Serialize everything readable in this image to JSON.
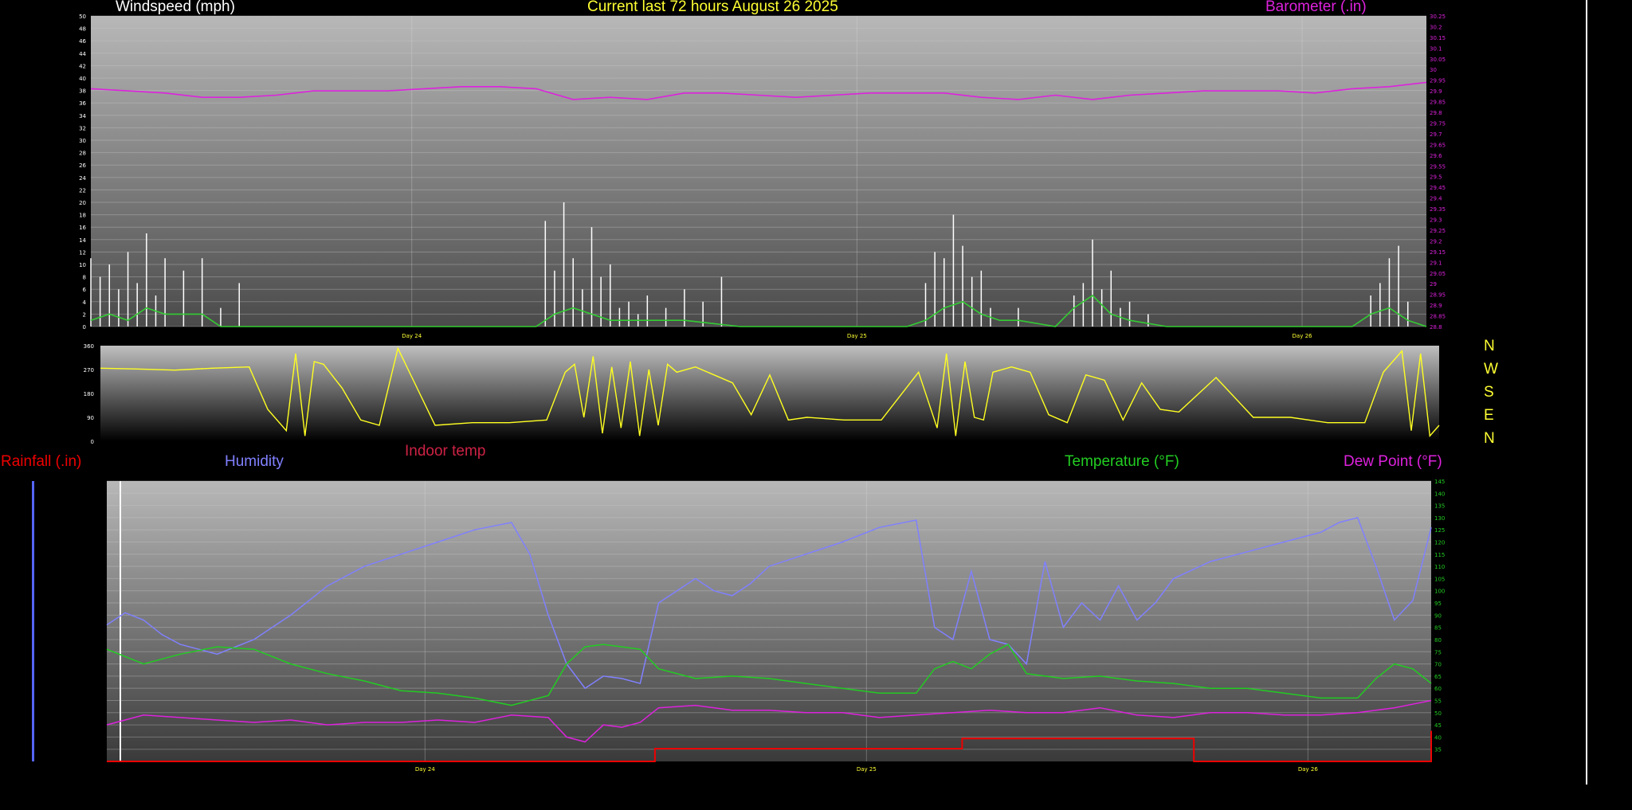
{
  "header": {
    "windspeed_label": "Windspeed (mph)",
    "title": "Current last 72 hours August 26 2025",
    "barometer_label": "Barometer (.in)"
  },
  "lower_legend": {
    "rainfall": "Rainfall (.in)",
    "humidity": "Humidity",
    "indoor_temp": "Indoor temp",
    "temperature": "Temperature (°F)",
    "dew_point": "Dew Point (°F)"
  },
  "compass": [
    "N",
    "W",
    "S",
    "E",
    "N"
  ],
  "colors": {
    "wind_gust": "#ffffff",
    "wind_avg": "#33cc33",
    "barometer": "#dd22dd",
    "direction": "#ffff22",
    "humidity": "#8080ff",
    "temperature": "#22cc22",
    "dew_point": "#dd22dd",
    "rainfall": "#ee0000",
    "indoor_temp": "#cc2244",
    "title": "#ffff33"
  },
  "chart_data": [
    {
      "type": "line",
      "title": "Current last 72 hours August 26 2025",
      "day_labels": [
        "Day 24",
        "Day 25",
        "Day 26"
      ],
      "x_unit": "hours",
      "xlim": [
        0,
        72
      ],
      "day_marks": [
        17.3,
        41.3,
        65.3
      ],
      "y_left": {
        "label": "Windspeed (mph)",
        "lim": [
          0,
          50
        ],
        "ticks": [
          0,
          2,
          4,
          6,
          8,
          10,
          12,
          14,
          16,
          18,
          20,
          22,
          24,
          26,
          28,
          30,
          32,
          34,
          36,
          38,
          40,
          42,
          44,
          46,
          48,
          50
        ]
      },
      "y_right": {
        "label": "Barometer (.in)",
        "lim": [
          28.8,
          30.25
        ],
        "ticks": [
          "28.8",
          "28.85",
          "28.9",
          "28.95",
          "29",
          "29.05",
          "29.1",
          "29.15",
          "29.2",
          "29.25",
          "29.3",
          "29.35",
          "29.4",
          "29.45",
          "29.5",
          "29.55",
          "29.6",
          "29.65",
          "29.7",
          "29.75",
          "29.8",
          "29.85",
          "29.9",
          "29.95",
          "30",
          "30.05",
          "30.1",
          "30.15",
          "30.2",
          "30.25"
        ]
      },
      "series": [
        {
          "name": "Barometer (.in)",
          "axis": "right",
          "x": [
            0,
            2,
            4,
            6,
            8,
            10,
            12,
            14,
            16,
            18,
            20,
            22,
            24,
            26,
            28,
            30,
            32,
            34,
            36,
            38,
            40,
            42,
            44,
            46,
            48,
            50,
            52,
            54,
            56,
            58,
            60,
            62,
            64,
            66,
            68,
            70,
            72
          ],
          "y": [
            29.91,
            29.9,
            29.89,
            29.87,
            29.87,
            29.88,
            29.9,
            29.9,
            29.9,
            29.91,
            29.92,
            29.92,
            29.91,
            29.86,
            29.87,
            29.86,
            29.89,
            29.89,
            29.88,
            29.87,
            29.88,
            29.89,
            29.89,
            29.89,
            29.87,
            29.86,
            29.88,
            29.86,
            29.88,
            29.89,
            29.9,
            29.9,
            29.9,
            29.89,
            29.91,
            29.92,
            29.94
          ]
        },
        {
          "name": "Wind gust",
          "axis": "left",
          "x": [
            0,
            0.5,
            1,
            1.5,
            2,
            2.5,
            3,
            3.5,
            4,
            5,
            6,
            7,
            8,
            10,
            12,
            14,
            16,
            20,
            22,
            24,
            24.5,
            25,
            25.5,
            26,
            26.5,
            27,
            27.5,
            28,
            28.5,
            29,
            29.5,
            30,
            31,
            32,
            33,
            34,
            35,
            40,
            42,
            44,
            45,
            45.5,
            46,
            46.5,
            47,
            47.5,
            48,
            48.5,
            50,
            52,
            53,
            53.5,
            54,
            54.5,
            55,
            55.5,
            56,
            57,
            58,
            60,
            64,
            68,
            69,
            69.5,
            70,
            70.5,
            71
          ],
          "y": [
            11,
            8,
            10,
            6,
            12,
            7,
            15,
            5,
            11,
            9,
            11,
            3,
            7,
            0,
            0,
            0,
            0,
            0,
            0,
            0,
            17,
            9,
            20,
            11,
            6,
            16,
            8,
            10,
            3,
            4,
            2,
            5,
            3,
            6,
            4,
            8,
            0,
            0,
            0,
            0,
            7,
            12,
            11,
            18,
            13,
            8,
            9,
            3,
            3,
            0,
            5,
            7,
            14,
            6,
            9,
            3,
            4,
            2,
            0,
            0,
            0,
            0,
            5,
            7,
            11,
            13,
            4
          ],
          "style": "bars"
        },
        {
          "name": "Wind average",
          "axis": "left",
          "x": [
            0,
            1,
            2,
            3,
            4,
            5,
            6,
            7,
            8,
            10,
            24,
            25,
            26,
            27,
            28,
            30,
            32,
            35,
            44,
            45,
            46,
            47,
            48,
            49,
            50,
            52,
            53,
            54,
            55,
            56,
            58,
            68,
            69,
            70,
            71,
            72
          ],
          "y": [
            1,
            2,
            1,
            3,
            2,
            2,
            2,
            0,
            0,
            0,
            0,
            2,
            3,
            2,
            1,
            1,
            1,
            0,
            0,
            1,
            3,
            4,
            2,
            1,
            1,
            0,
            3,
            5,
            2,
            1,
            0,
            0,
            2,
            3,
            1,
            0
          ]
        }
      ]
    },
    {
      "type": "line",
      "title": "",
      "xlim": [
        0,
        72
      ],
      "ylim": [
        0,
        360
      ],
      "yticks": [
        0,
        90,
        180,
        270,
        360
      ],
      "series": [
        {
          "name": "Wind direction",
          "axis": "left",
          "x": [
            0,
            2,
            4,
            6,
            8,
            9,
            10,
            10.5,
            11,
            11.5,
            12,
            13,
            14,
            15,
            16,
            18,
            20,
            22,
            24,
            25,
            25.5,
            26,
            26.5,
            27,
            27.5,
            28,
            28.5,
            29,
            29.5,
            30,
            30.5,
            31,
            32,
            33,
            34,
            35,
            36,
            37,
            38,
            40,
            42,
            44,
            45,
            45.5,
            46,
            46.5,
            47,
            47.5,
            48,
            49,
            50,
            51,
            52,
            53,
            54,
            55,
            56,
            57,
            58,
            60,
            62,
            64,
            66,
            68,
            69,
            70,
            70.5,
            71,
            71.5,
            72
          ],
          "y": [
            275,
            272,
            268,
            275,
            280,
            120,
            40,
            330,
            20,
            300,
            290,
            200,
            80,
            60,
            350,
            60,
            70,
            70,
            80,
            260,
            290,
            90,
            320,
            30,
            280,
            50,
            300,
            20,
            270,
            60,
            290,
            260,
            280,
            250,
            220,
            100,
            250,
            80,
            90,
            80,
            80,
            260,
            50,
            330,
            20,
            300,
            90,
            80,
            260,
            280,
            260,
            100,
            70,
            250,
            230,
            80,
            220,
            120,
            110,
            240,
            90,
            90,
            70,
            70,
            260,
            340,
            40,
            330,
            20,
            60
          ]
        }
      ]
    },
    {
      "type": "line",
      "title": "",
      "xlim": [
        0,
        72
      ],
      "y_left_rain": {
        "label": "Rainfall (.in)",
        "lim": [
          0,
          1.1
        ]
      },
      "y_right": {
        "label": "Temperature (°F)",
        "lim": [
          30,
          145
        ],
        "ticks": [
          35,
          40,
          45,
          50,
          55,
          60,
          65,
          70,
          75,
          80,
          85,
          90,
          95,
          100,
          105,
          110,
          115,
          120,
          125,
          130,
          135,
          140,
          145
        ]
      },
      "series": [
        {
          "name": "Humidity",
          "axis": "right",
          "x": [
            0,
            1,
            2,
            3,
            4,
            5,
            6,
            7,
            8,
            10,
            12,
            14,
            16,
            18,
            20,
            22,
            23,
            24,
            25,
            26,
            27,
            28,
            29,
            30,
            31,
            32,
            33,
            34,
            35,
            36,
            38,
            40,
            42,
            44,
            45,
            46,
            47,
            48,
            49,
            50,
            51,
            52,
            53,
            54,
            55,
            56,
            57,
            58,
            60,
            62,
            64,
            66,
            67,
            68,
            69,
            70,
            71,
            72
          ],
          "y": [
            86,
            91,
            88,
            82,
            78,
            76,
            74,
            77,
            80,
            90,
            102,
            110,
            115,
            120,
            125,
            128,
            115,
            90,
            70,
            60,
            65,
            64,
            62,
            95,
            100,
            105,
            100,
            98,
            103,
            110,
            115,
            120,
            126,
            129,
            85,
            80,
            108,
            80,
            78,
            70,
            112,
            85,
            95,
            88,
            102,
            88,
            95,
            105,
            112,
            116,
            120,
            124,
            128,
            130,
            110,
            88,
            96,
            126
          ]
        },
        {
          "name": "Temperature (°F)",
          "axis": "right",
          "x": [
            0,
            2,
            4,
            6,
            8,
            10,
            12,
            14,
            16,
            18,
            20,
            22,
            24,
            25,
            26,
            27,
            28,
            29,
            30,
            32,
            34,
            36,
            38,
            40,
            42,
            44,
            45,
            46,
            47,
            48,
            49,
            50,
            52,
            54,
            56,
            58,
            60,
            62,
            64,
            66,
            68,
            69,
            70,
            71,
            72
          ],
          "y": [
            76,
            70,
            74,
            77,
            76,
            70,
            66,
            63,
            59,
            58,
            56,
            53,
            57,
            70,
            77,
            78,
            77,
            76,
            68,
            64,
            65,
            64,
            62,
            60,
            58,
            58,
            68,
            71,
            68,
            74,
            78,
            66,
            64,
            65,
            63,
            62,
            60,
            60,
            58,
            56,
            56,
            64,
            70,
            68,
            62
          ]
        },
        {
          "name": "Dew Point (°F)",
          "axis": "right",
          "x": [
            0,
            2,
            4,
            6,
            8,
            10,
            12,
            14,
            16,
            18,
            20,
            22,
            24,
            25,
            26,
            27,
            28,
            29,
            30,
            32,
            34,
            36,
            38,
            40,
            42,
            44,
            46,
            48,
            50,
            52,
            54,
            56,
            58,
            60,
            62,
            64,
            66,
            68,
            70,
            72
          ],
          "y": [
            45,
            49,
            48,
            47,
            46,
            47,
            45,
            46,
            46,
            47,
            46,
            49,
            48,
            40,
            38,
            45,
            44,
            46,
            52,
            53,
            51,
            51,
            50,
            50,
            48,
            49,
            50,
            51,
            50,
            50,
            52,
            49,
            48,
            50,
            50,
            49,
            49,
            50,
            52,
            55
          ]
        },
        {
          "name": "Rainfall (.in)",
          "axis": "left_rain",
          "x": [
            0,
            29.5,
            29.8,
            30,
            46.3,
            46.5,
            59,
            59.1,
            71.3,
            72
          ],
          "y": [
            0,
            0,
            0.05,
            0.05,
            0.05,
            0.09,
            0.09,
            0.0,
            0.0,
            0.12
          ],
          "style": "step"
        }
      ]
    }
  ]
}
